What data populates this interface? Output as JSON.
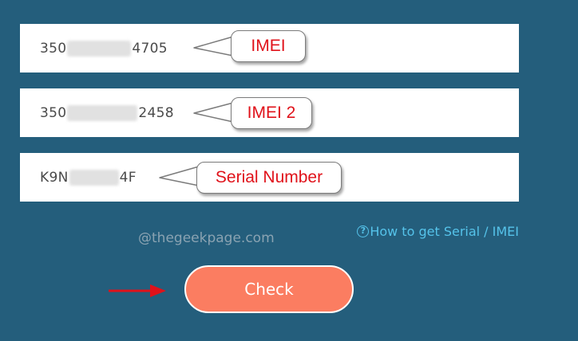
{
  "fields": {
    "imei": {
      "prefix": "350",
      "suffix": "4705"
    },
    "imei2": {
      "prefix": "350",
      "suffix": "2458"
    },
    "serial": {
      "prefix": "K9N",
      "suffix": "4F"
    }
  },
  "callouts": {
    "imei": "IMEI",
    "imei2": "IMEI 2",
    "serial": "Serial Number"
  },
  "help": {
    "icon": "?",
    "label": "How to get Serial / IMEI"
  },
  "watermark": "@thegeekpage.com",
  "button": {
    "label": "Check"
  },
  "colors": {
    "background": "#245e7c",
    "button": "#fb7d61",
    "link": "#55c3ea",
    "annotation": "#e0121a"
  }
}
